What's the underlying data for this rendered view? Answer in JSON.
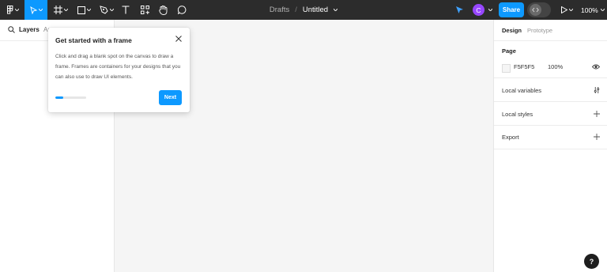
{
  "toolbar": {
    "breadcrumb": "Drafts",
    "separator": "/",
    "file_name": "Untitled",
    "share_label": "Share",
    "zoom": "100%",
    "avatar_initial": "C",
    "accent": "#0d99ff",
    "avatar_color": "#9747ff",
    "tools": [
      "main-menu-icon",
      "move-tool-icon",
      "frame-tool-icon",
      "shape-tool-icon",
      "pen-tool-icon",
      "text-tool-icon",
      "resources-icon",
      "hand-tool-icon",
      "comment-tool-icon"
    ]
  },
  "left_panel": {
    "tabs": [
      "Layers",
      "As"
    ]
  },
  "right_panel": {
    "tabs": [
      "Design",
      "Prototype"
    ],
    "page": {
      "title": "Page",
      "color": "F5F5F5",
      "opacity": "100%"
    },
    "sections": [
      "Local variables",
      "Local styles",
      "Export"
    ]
  },
  "popover": {
    "title": "Get started with a frame",
    "body": "Click and drag a blank spot on the canvas to draw a frame. Frames are containers for your designs that you can also use to draw UI elements.",
    "next_label": "Next",
    "progress": 0.25
  },
  "help_label": "?"
}
